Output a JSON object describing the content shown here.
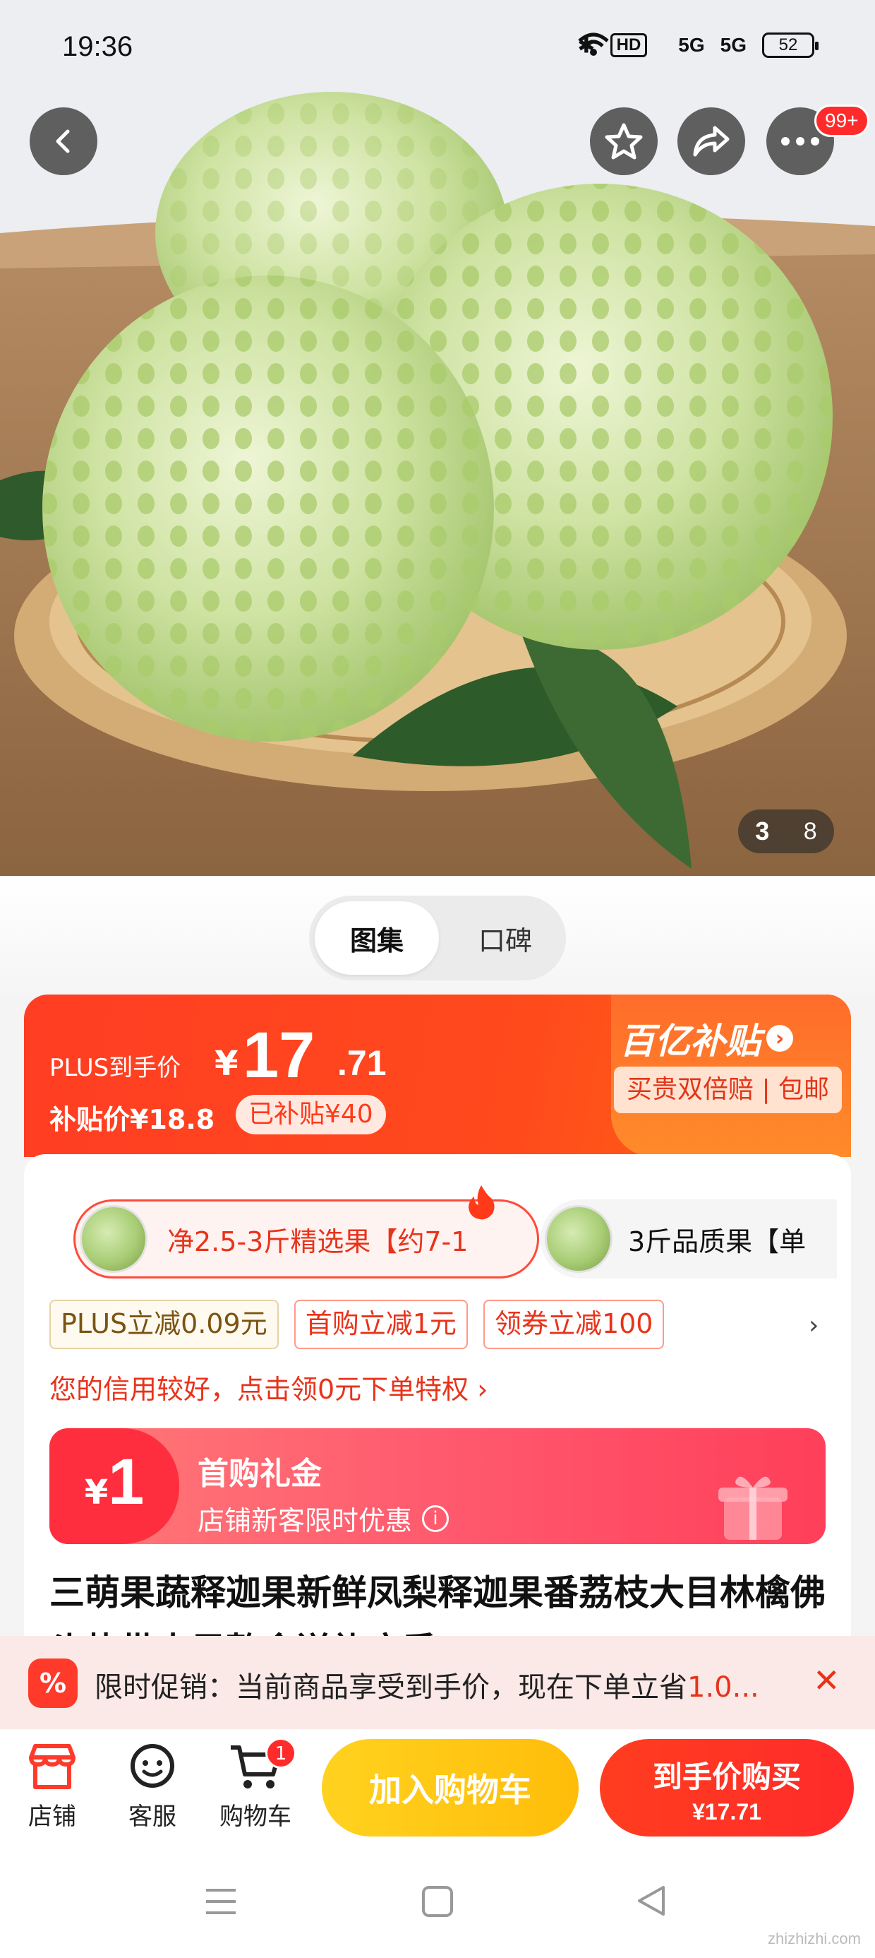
{
  "status_bar": {
    "time": "19:36",
    "hd_label": "HD",
    "signal_1": "5G",
    "signal_2": "5G",
    "battery": "52"
  },
  "top_bar": {
    "more_badge": "99+"
  },
  "gallery": {
    "current_index": "3",
    "total": "8"
  },
  "view_toggle": {
    "active": "图集",
    "inactive": "口碑"
  },
  "price_banner": {
    "label": "PLUS到手价",
    "currency": "¥",
    "price_int": "17",
    "price_dec": ".71",
    "subsidy_price": "补贴价¥18.8",
    "subsidy_tag": "已补贴¥40",
    "brand": "百亿补贴",
    "guarantee": "买贵双倍赔 | 包邮",
    "accent_color": "#ff4a1c"
  },
  "variants": [
    {
      "label": "净2.5-3斤精选果【约7-1",
      "selected": true
    },
    {
      "label": "3斤品质果【单",
      "selected": false
    }
  ],
  "coupons": [
    {
      "label": "PLUS立减0.09元",
      "kind": "plus"
    },
    {
      "label": "首购立减1元",
      "kind": "red"
    },
    {
      "label": "领券立减100",
      "kind": "red"
    }
  ],
  "credit_notice": "您的信用较好，点击领0元下单特权 ›",
  "gift_card": {
    "currency": "¥",
    "amount": "1",
    "title": "首购礼金",
    "subtitle": "店铺新客限时优惠"
  },
  "product_title": "三萌果蔬释迦果新鲜凤梨释迦果番荔枝大目林檎佛头热带水果整盒送礼应季",
  "promo_strip": {
    "icon": "%",
    "text_prefix": "限时促销：当前商品享受到手价，现在下单立省",
    "text_highlight": "1.0...",
    "close": "✕"
  },
  "bottom_tabs": [
    {
      "label": "店铺",
      "icon": "store-icon"
    },
    {
      "label": "客服",
      "icon": "chat-icon"
    },
    {
      "label": "购物车",
      "icon": "cart-icon"
    }
  ],
  "cart_badge": "1",
  "add_to_cart": "加入购物车",
  "buy_now": {
    "label": "到手价购买",
    "price": "¥17.71"
  },
  "watermark": "zhizhizhi.com"
}
